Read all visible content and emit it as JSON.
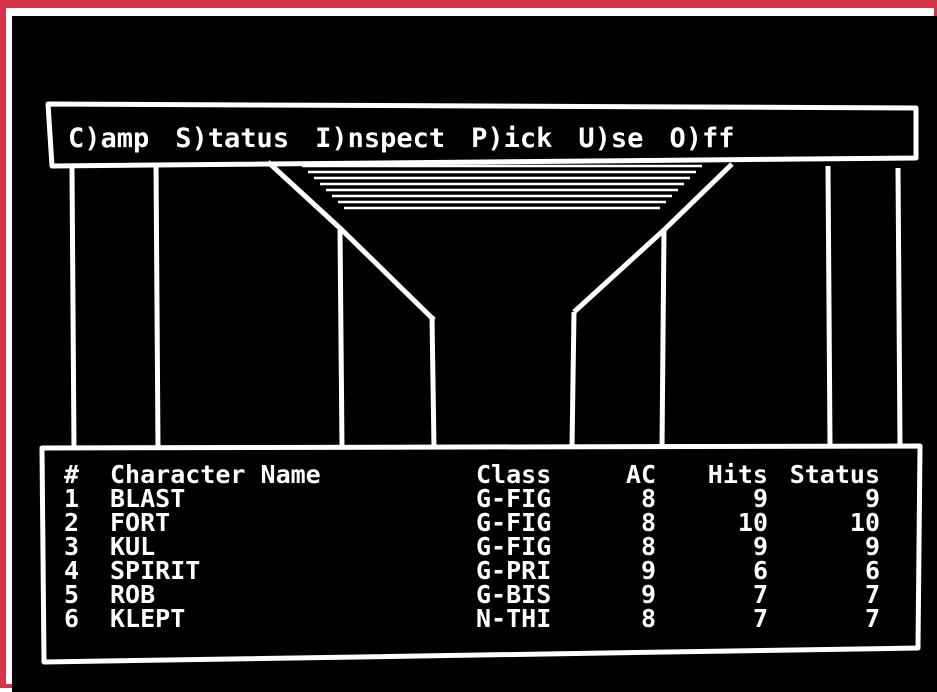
{
  "colors": {
    "screen_bg": "#000000",
    "foreground": "#ffffff",
    "border": "#d8324a"
  },
  "menu": {
    "items": [
      {
        "key": "camp",
        "label": "C)amp"
      },
      {
        "key": "status",
        "label": "S)tatus"
      },
      {
        "key": "inspect",
        "label": "I)nspect"
      },
      {
        "key": "pick",
        "label": "P)ick"
      },
      {
        "key": "use",
        "label": "U)se"
      },
      {
        "key": "off",
        "label": "O)ff"
      }
    ]
  },
  "party": {
    "headers": {
      "num": "#",
      "name": "Character Name",
      "class": "Class",
      "ac": "AC",
      "hits": "Hits",
      "status": "Status"
    },
    "rows": [
      {
        "num": "1",
        "name": "BLAST",
        "class": "G-FIG",
        "ac": "8",
        "hits": "9",
        "status": "9"
      },
      {
        "num": "2",
        "name": "FORT",
        "class": "G-FIG",
        "ac": "8",
        "hits": "10",
        "status": "10"
      },
      {
        "num": "3",
        "name": "KUL",
        "class": "G-FIG",
        "ac": "8",
        "hits": "9",
        "status": "9"
      },
      {
        "num": "4",
        "name": "SPIRIT",
        "class": "G-PRI",
        "ac": "9",
        "hits": "6",
        "status": "6"
      },
      {
        "num": "5",
        "name": "ROB",
        "class": "G-BIS",
        "ac": "9",
        "hits": "7",
        "status": "7"
      },
      {
        "num": "6",
        "name": "KLEPT",
        "class": "N-THI",
        "ac": "8",
        "hits": "7",
        "status": "7"
      }
    ]
  }
}
